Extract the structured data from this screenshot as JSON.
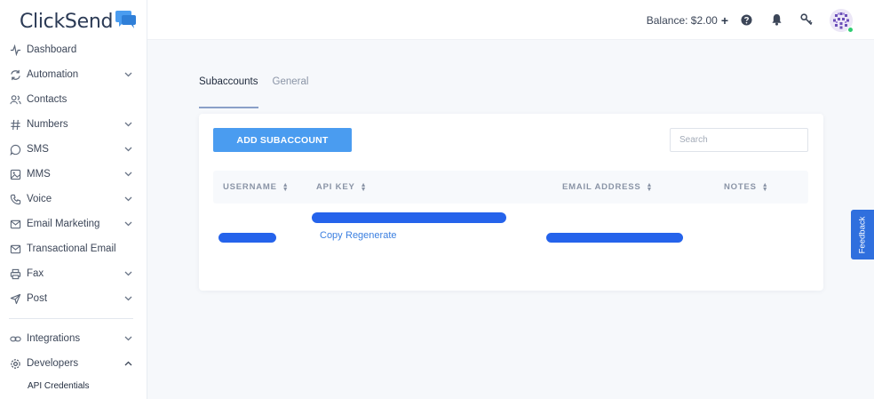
{
  "brand": {
    "name": "ClickSend",
    "accent": "#4a9cf0"
  },
  "sidebar": {
    "items": [
      {
        "label": "Dashboard",
        "icon": "activity-icon",
        "chevron": false
      },
      {
        "label": "Automation",
        "icon": "refresh-icon",
        "chevron": true
      },
      {
        "label": "Contacts",
        "icon": "users-icon",
        "chevron": false
      },
      {
        "label": "Numbers",
        "icon": "hash-icon",
        "chevron": true
      },
      {
        "label": "SMS",
        "icon": "chat-bubble-icon",
        "chevron": true
      },
      {
        "label": "MMS",
        "icon": "image-icon",
        "chevron": true
      },
      {
        "label": "Voice",
        "icon": "phone-icon",
        "chevron": true
      },
      {
        "label": "Email Marketing",
        "icon": "mail-icon",
        "chevron": true
      },
      {
        "label": "Transactional Email",
        "icon": "mail-icon",
        "chevron": false
      },
      {
        "label": "Fax",
        "icon": "printer-icon",
        "chevron": true
      },
      {
        "label": "Post",
        "icon": "send-icon",
        "chevron": true
      },
      {
        "label": "Integrations",
        "icon": "link-icon",
        "chevron": true
      },
      {
        "label": "Developers",
        "icon": "gear-icon",
        "chevron": true
      }
    ],
    "sub_item": "API Credentials"
  },
  "topbar": {
    "balance_label": "Balance: $2.00",
    "plus": "+",
    "icons": [
      "help-icon",
      "bell-icon",
      "key-icon",
      "avatar"
    ]
  },
  "tabs": [
    {
      "label": "Subaccounts",
      "active": true
    },
    {
      "label": "General",
      "active": false
    }
  ],
  "card": {
    "add_button": "ADD SUBACCOUNT",
    "search_placeholder": "Search",
    "columns": [
      "USERNAME",
      "API KEY",
      "EMAIL ADDRESS",
      "NOTES"
    ],
    "row": {
      "copy_label": "Copy",
      "regenerate_label": "Regenerate",
      "redaction_color": "#2563eb"
    }
  },
  "feedback_label": "Feedback"
}
